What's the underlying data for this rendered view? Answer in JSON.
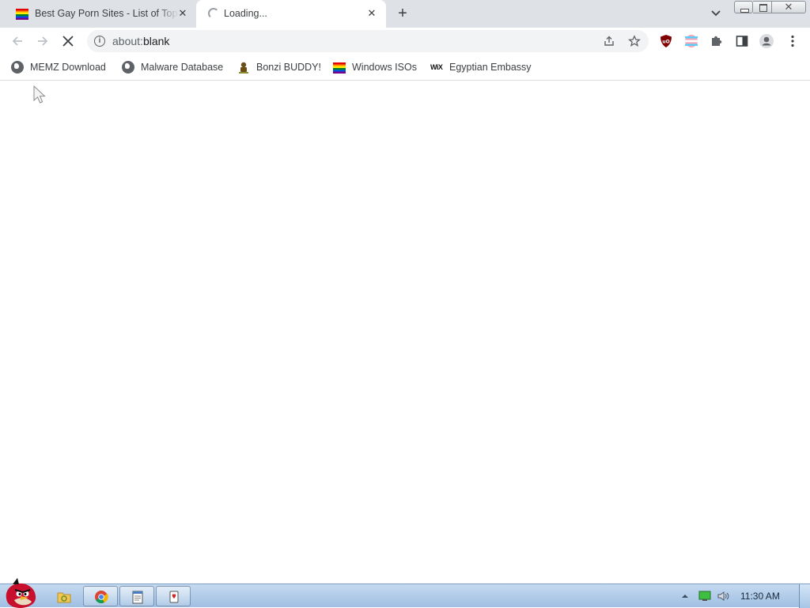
{
  "tabs": [
    {
      "title": "Best Gay Porn Sites - List of Top",
      "favicon": "rainbow-flag-icon",
      "active": false
    },
    {
      "title": "Loading...",
      "favicon": "loading-spinner-icon",
      "active": true
    }
  ],
  "toolbar": {
    "url_scheme": "about:",
    "url_rest": "blank"
  },
  "bookmarks": [
    {
      "label": "MEMZ Download",
      "icon": "globe-icon"
    },
    {
      "label": "Malware Database",
      "icon": "globe-icon"
    },
    {
      "label": "Bonzi BUDDY!",
      "icon": "bonzi-icon"
    },
    {
      "label": "Windows ISOs",
      "icon": "rainbow-flag-icon"
    },
    {
      "label": "Egyptian Embassy",
      "icon": "wix-icon"
    }
  ],
  "taskbar": {
    "clock": "11:30 AM",
    "apps": [
      "explorer-icon",
      "chrome-icon",
      "notepad-icon",
      "solitaire-icon"
    ]
  },
  "colors": {
    "tabstrip_bg": "#dee1e6",
    "omnibox_bg": "#f1f3f4",
    "taskbar_top": "#c5daf0",
    "taskbar_bottom": "#9fbfe2"
  }
}
